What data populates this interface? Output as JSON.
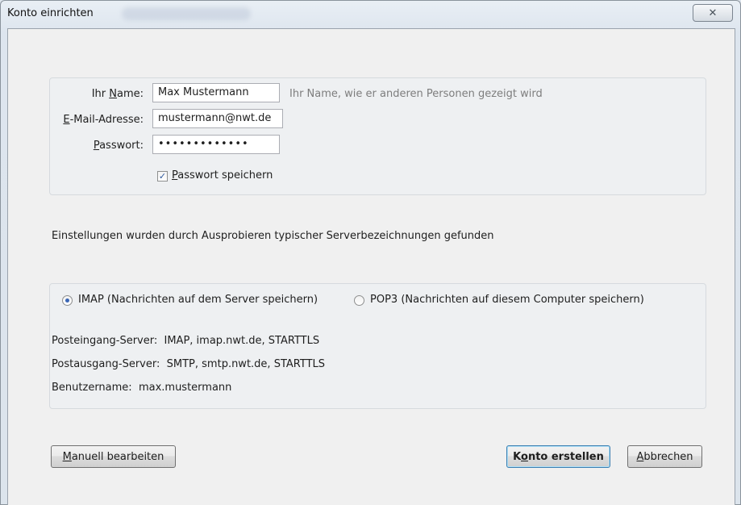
{
  "window": {
    "title": "Konto einrichten",
    "close_label": "✕"
  },
  "form": {
    "name_label_pre": "Ihr ",
    "name_label_key": "N",
    "name_label_post": "ame:",
    "name_value": "Max Mustermann",
    "name_hint": "Ihr Name, wie er anderen Personen gezeigt wird",
    "email_label_key": "E",
    "email_label_post": "-Mail-Adresse:",
    "email_value": "mustermann@nwt.de",
    "password_label_key": "P",
    "password_label_post": "asswort:",
    "password_value": "•••••••••••••",
    "save_password_key": "P",
    "save_password_post": "asswort speichern",
    "save_password_checked": true
  },
  "status_text": "Einstellungen wurden durch Ausprobieren typischer Serverbezeichnungen gefunden",
  "server": {
    "imap_label": "IMAP (Nachrichten auf dem Server speichern)",
    "pop3_label": "POP3 (Nachrichten auf diesem Computer speichern)",
    "selected": "imap",
    "incoming_label": "Posteingang-Server:",
    "incoming_value": "IMAP, imap.nwt.de, STARTTLS",
    "outgoing_label": "Postausgang-Server:",
    "outgoing_value": "SMTP, smtp.nwt.de, STARTTLS",
    "username_label": "Benutzername:",
    "username_value": "max.mustermann"
  },
  "buttons": {
    "manual_key": "M",
    "manual_post": "anuell bearbeiten",
    "create_pre": "K",
    "create_key": "o",
    "create_post": "nto erstellen",
    "cancel_key": "A",
    "cancel_post": "bbrechen"
  },
  "colors": {
    "accent": "#3a66b5",
    "hint": "#7d7d7d",
    "dialog_bg": "#f0f0f0"
  }
}
